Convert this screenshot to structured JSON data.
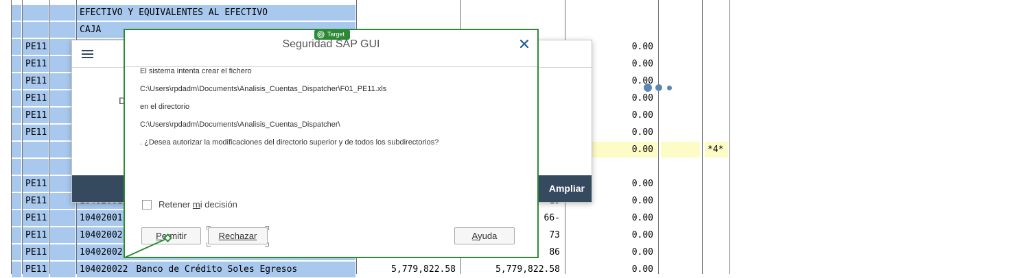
{
  "report": {
    "rows": [
      {
        "soc": "",
        "cuenta": "",
        "texto": "EFECTIVO Y EQUIVALENTES AL EFECTIVO",
        "v1": "",
        "v2": "",
        "v3": "",
        "flag": "",
        "highlight": false
      },
      {
        "soc": "",
        "cuenta": "",
        "texto": "CAJA",
        "v1": "",
        "v2": "",
        "v3": "",
        "flag": "",
        "highlight": false
      },
      {
        "soc": "PE11",
        "cuenta": "",
        "texto": "",
        "v1": "",
        "v2": "",
        "v3": "0.00",
        "flag": "",
        "highlight": false
      },
      {
        "soc": "PE11",
        "cuenta": "",
        "texto": "",
        "v1": "",
        "v2": "",
        "v3": "0.00",
        "flag": "",
        "highlight": false
      },
      {
        "soc": "PE11",
        "cuenta": "",
        "texto": "",
        "v1": "",
        "v2": "",
        "v3": "0.00",
        "flag": "",
        "highlight": false
      },
      {
        "soc": "PE11",
        "cuenta": "",
        "texto": "",
        "v1": "",
        "v2": "",
        "v3": "0.00",
        "flag": "",
        "highlight": false
      },
      {
        "soc": "PE11",
        "cuenta": "",
        "texto": "",
        "v1": "",
        "v2": "",
        "v3": "0.00",
        "flag": "",
        "highlight": false
      },
      {
        "soc": "PE11",
        "cuenta": "",
        "texto": "",
        "v1": "",
        "v2": "",
        "v3": "0.00",
        "flag": "",
        "highlight": false
      },
      {
        "soc": "",
        "cuenta": "",
        "texto": "",
        "v1": "",
        "v2": "",
        "v3": "0.00",
        "flag": "*4*",
        "highlight": true
      },
      {
        "soc": "",
        "cuenta": "",
        "texto": "",
        "v1": "",
        "v2": "",
        "v3": "",
        "flag": "",
        "highlight": false
      },
      {
        "soc": "PE11",
        "cuenta": "",
        "texto": "",
        "v1": "",
        "v2": "",
        "v3": "0.00",
        "flag": "",
        "highlight": false
      },
      {
        "soc": "PE11",
        "cuenta": "10402001",
        "texto": "",
        "v1": "",
        "v2": "19",
        "v3": "0.00",
        "flag": "",
        "highlight": false
      },
      {
        "soc": "PE11",
        "cuenta": "10402001",
        "texto": "",
        "v1": "",
        "v2": "66-",
        "v3": "0.00",
        "flag": "",
        "highlight": false
      },
      {
        "soc": "PE11",
        "cuenta": "10402002",
        "texto": "",
        "v1": "",
        "v2": "73",
        "v3": "0.00",
        "flag": "",
        "highlight": false
      },
      {
        "soc": "PE11",
        "cuenta": "10402002",
        "texto": "",
        "v1": "",
        "v2": "86",
        "v3": "0.00",
        "flag": "",
        "highlight": false
      },
      {
        "soc": "PE11",
        "cuenta": "104020022",
        "texto": "Banco de Crédito Soles Egresos",
        "v1": "5,779,822.58",
        "v2": "5,779,822.58",
        "v3": "0.00",
        "flag": "",
        "highlight": false
      }
    ]
  },
  "fiori": {
    "partial_text": "D",
    "footer_button": "Ampliar"
  },
  "dialog": {
    "title": "Seguridad SAP GUI",
    "lines": [
      "El sistema intenta crear el fichero",
      "C:\\Users\\rpdadm\\Documents\\Analisis_Cuentas_Dispatcher\\F01_PE11.xls",
      "en el directorio",
      "C:\\Users\\rpdadm\\Documents\\Analisis_Cuentas_Dispatcher\\",
      ". ¿Desea autorizar la modificaciones del directorio superior y de todos los subdirectorios?"
    ],
    "checkbox_label": "Retener mi decisión",
    "checkbox_checked": false,
    "buttons": {
      "allow": "Permitir",
      "reject": "Rechazar",
      "help": "Ayuda"
    }
  },
  "overlay": {
    "target_label": "Target"
  },
  "colors": {
    "selection_blue": "#a8c8ee",
    "highlight_yellow": "#fdfbc6",
    "target_green": "#2c8a35",
    "fiori_footer": "#354a5f"
  }
}
